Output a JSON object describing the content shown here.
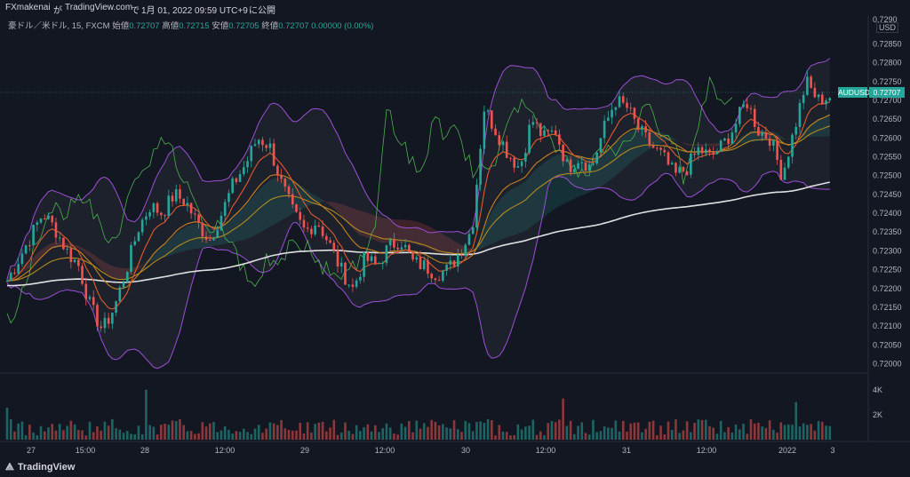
{
  "header": {
    "user": "FXmakenai",
    "text_ga": "が",
    "site": "TradingView.com",
    "text_de": "で",
    "date": "1月 01, 2022 09:59 UTC+9",
    "text_publish": "に公開"
  },
  "legend": {
    "symbol": "豪ドル／米ドル, 15, FXCM",
    "open_label": "始値",
    "open": "0.72707",
    "high_label": "高値",
    "high": "0.72715",
    "low_label": "安値",
    "low": "0.72705",
    "close_label": "終値",
    "close": "0.72707",
    "change": "0.00000 (0.00%)"
  },
  "price_axis": {
    "currency": "USD",
    "ticks": [
      "0.72850",
      "0.72800",
      "0.72750",
      "0.72700",
      "0.72650",
      "0.72600",
      "0.72550",
      "0.72500",
      "0.72450",
      "0.72400",
      "0.72350",
      "0.72300",
      "0.72250",
      "0.72200",
      "0.72150",
      "0.72100",
      "0.72050",
      "0.72000"
    ],
    "top_partial": "0.7290",
    "symbol_tag": "AUDUSD",
    "last_price": "0.72707"
  },
  "volume_axis": {
    "ticks": [
      "4K",
      "2K"
    ]
  },
  "time_axis": {
    "ticks": [
      "27",
      "15:00",
      "28",
      "12:00",
      "29",
      "12:00",
      "30",
      "12:00",
      "31",
      "12:00",
      "2022",
      "3"
    ]
  },
  "footer": {
    "brand": "TradingView"
  },
  "colors": {
    "background": "#131722",
    "up": "#26a69a",
    "down": "#ef5350",
    "bollinger": "#9c4fd6",
    "sma_long": "#e0e0e0",
    "ema_fast": "#e05a2b",
    "ema_mid": "#c7821f",
    "ema_slow": "#b58a1e",
    "chikou": "#4caf50"
  },
  "chart_data": {
    "type": "candlestick",
    "symbol": "AUDUSD",
    "timeframe": "15",
    "ylim": [
      0.7198,
      0.7291
    ],
    "x_sessions": [
      "27",
      "15:00",
      "28",
      "12:00",
      "29",
      "12:00",
      "30",
      "12:00",
      "31",
      "12:00",
      "2022",
      "3"
    ],
    "price_path": [
      0.7222,
      0.7228,
      0.7234,
      0.724,
      0.7236,
      0.723,
      0.7226,
      0.7215,
      0.7209,
      0.7215,
      0.7225,
      0.7236,
      0.7242,
      0.724,
      0.7245,
      0.7243,
      0.7237,
      0.7233,
      0.724,
      0.7248,
      0.7253,
      0.726,
      0.7258,
      0.7248,
      0.724,
      0.7235,
      0.7238,
      0.7232,
      0.7225,
      0.722,
      0.7228,
      0.7226,
      0.7231,
      0.7233,
      0.7227,
      0.7226,
      0.7224,
      0.7225,
      0.723,
      0.7236,
      0.7268,
      0.7262,
      0.7256,
      0.7252,
      0.7265,
      0.726,
      0.7262,
      0.7252,
      0.7255,
      0.7252,
      0.7262,
      0.727,
      0.7268,
      0.7262,
      0.7258,
      0.7255,
      0.725,
      0.7252,
      0.7257,
      0.7255,
      0.7258,
      0.7263,
      0.727,
      0.7262,
      0.726,
      0.725,
      0.7262,
      0.7275,
      0.727,
      0.7271
    ],
    "indicators": [
      "Bollinger Bands",
      "SMA (long)",
      "EMA (fast)",
      "EMA (mid)",
      "EMA (slow)",
      "Ichimoku cloud",
      "Chikou span"
    ],
    "volume_max": 4500
  }
}
